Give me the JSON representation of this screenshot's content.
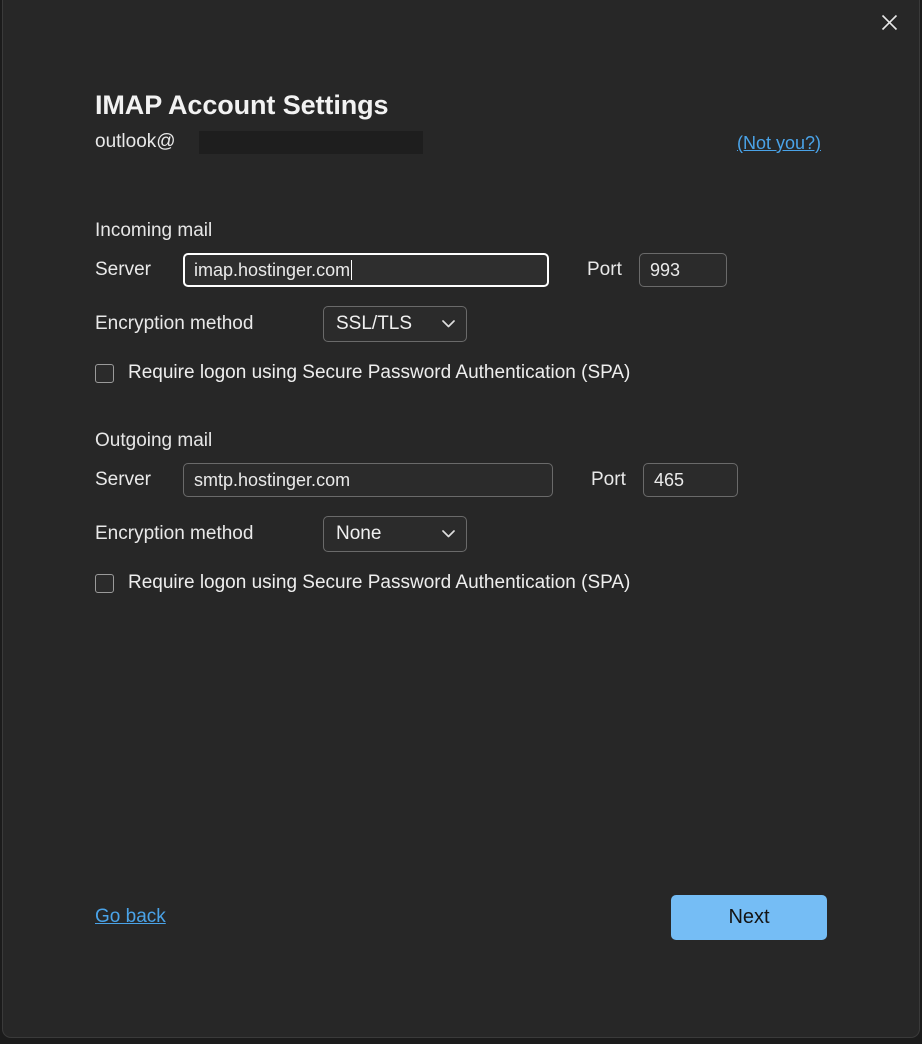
{
  "window": {
    "close_icon": "close-icon",
    "background_color": "#272727"
  },
  "header": {
    "title": "IMAP Account Settings",
    "account_email": "outlook@",
    "account_email_redacted": true,
    "not_you_label": "(Not you?)",
    "link_color": "#4aa3e8"
  },
  "incoming": {
    "section_label": "Incoming mail",
    "server_label": "Server",
    "server_value": "imap.hostinger.com",
    "server_focused": true,
    "port_label": "Port",
    "port_value": "993",
    "encryption_label": "Encryption method",
    "encryption_value": "SSL/TLS",
    "encryption_chevron_icon": "chevron-down-icon",
    "spa_label": "Require logon using Secure Password Authentication (SPA)",
    "spa_checked": false
  },
  "outgoing": {
    "section_label": "Outgoing mail",
    "server_label": "Server",
    "server_value": "smtp.hostinger.com",
    "server_focused": false,
    "port_label": "Port",
    "port_value": "465",
    "encryption_label": "Encryption method",
    "encryption_value": "None",
    "encryption_chevron_icon": "chevron-down-icon",
    "spa_label": "Require logon using Secure Password Authentication (SPA)",
    "spa_checked": false
  },
  "footer": {
    "go_back_label": "Go back",
    "next_label": "Next",
    "next_button_color": "#75bdf5"
  }
}
